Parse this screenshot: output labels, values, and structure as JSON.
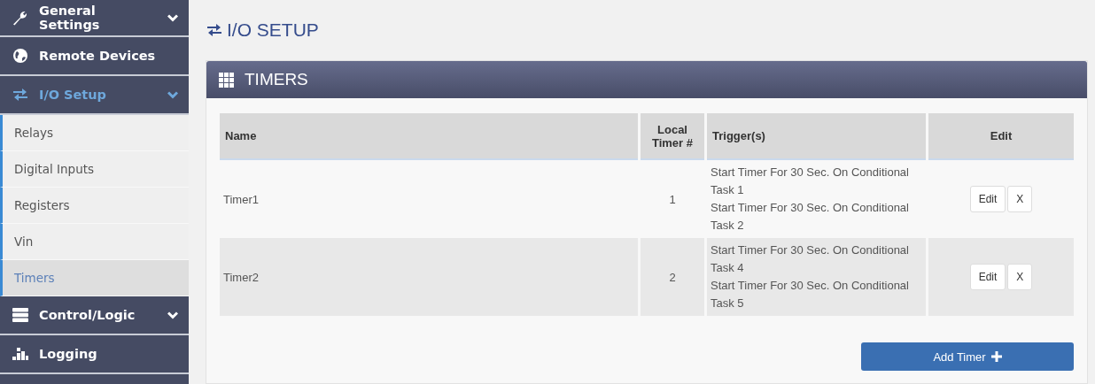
{
  "sidebar": {
    "items": [
      {
        "label": "General Settings",
        "expanded": false
      },
      {
        "label": "Remote Devices"
      },
      {
        "label": "I/O Setup",
        "expanded": true,
        "children": [
          {
            "label": "Relays",
            "selected": false
          },
          {
            "label": "Digital Inputs",
            "selected": false
          },
          {
            "label": "Registers",
            "selected": false
          },
          {
            "label": "Vin",
            "selected": false
          },
          {
            "label": "Timers",
            "selected": true
          }
        ]
      },
      {
        "label": "Control/Logic",
        "expanded": false
      },
      {
        "label": "Logging"
      }
    ]
  },
  "page_title": "I/O SETUP",
  "panel": {
    "title": "TIMERS",
    "table": {
      "columns": [
        "Name",
        "Local Timer #",
        "Trigger(s)",
        "Edit"
      ],
      "rows": [
        {
          "name": "Timer1",
          "local_timer": "1",
          "triggers": [
            "Start Timer For 30 Sec. On Conditional Task 1",
            "Start Timer For 30 Sec. On Conditional Task 2"
          ],
          "actions": [
            "Edit",
            "X"
          ]
        },
        {
          "name": "Timer2",
          "local_timer": "2",
          "triggers": [
            "Start Timer For 30 Sec. On Conditional Task 4",
            "Start Timer For 30 Sec. On Conditional Task 5"
          ],
          "actions": [
            "Edit",
            "X"
          ]
        }
      ]
    },
    "add_button": "Add Timer"
  }
}
